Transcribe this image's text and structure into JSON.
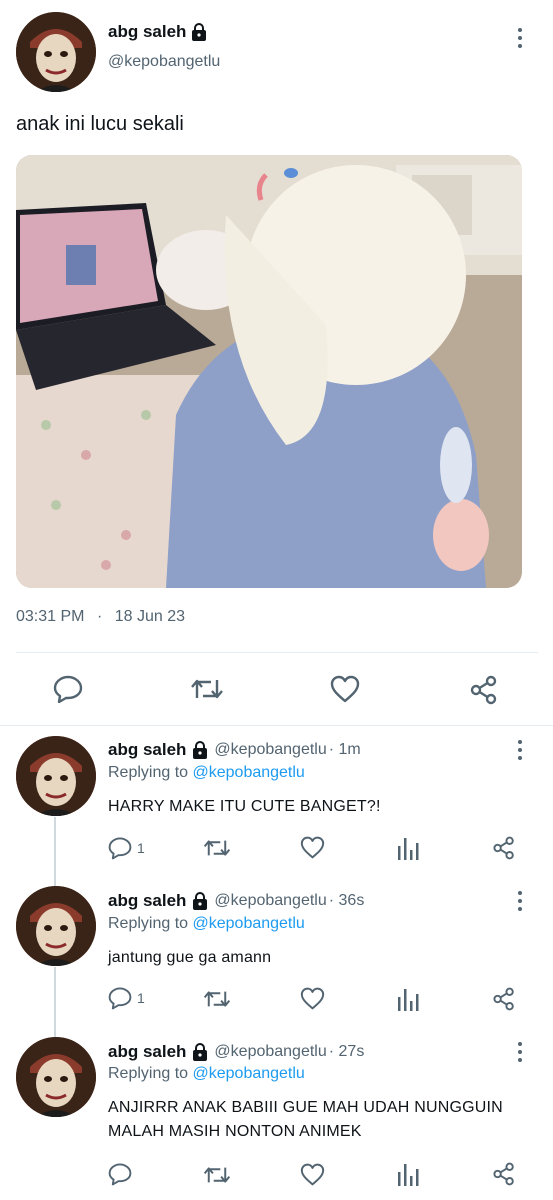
{
  "tweet": {
    "author_name": "abg saleh",
    "author_handle": "@kepobangetlu",
    "text": "anak ini lucu sekali",
    "time": "03:31 PM",
    "separator": "·",
    "date": "18 Jun 23"
  },
  "replies": [
    {
      "name": "abg saleh",
      "handle": "@kepobangetlu",
      "age": "· 1m",
      "replying_label": "Replying to",
      "replying_handle": "@kepobangetlu",
      "text": "HARRY MAKE ITU CUTE BANGET?!",
      "reply_count": "1"
    },
    {
      "name": "abg saleh",
      "handle": "@kepobangetlu",
      "age": "· 36s",
      "replying_label": "Replying to",
      "replying_handle": "@kepobangetlu",
      "text": "jantung gue ga amann",
      "reply_count": "1"
    },
    {
      "name": "abg saleh",
      "handle": "@kepobangetlu",
      "age": "· 27s",
      "replying_label": "Replying to",
      "replying_handle": "@kepobangetlu",
      "text_line1": "ANJIRRR ANAK BABIII GUE MAH UDAH NUNGGUIN",
      "text_line2": "MALAH MASIH NONTON ANIMEK",
      "reply_count": ""
    }
  ],
  "colors": {
    "accent": "#1d9bf0",
    "secondary_text": "#536471",
    "primary_text": "#0f1419",
    "divider": "#e6ecf0"
  },
  "icons": [
    "lock-icon",
    "more-icon",
    "reply-icon",
    "retweet-icon",
    "like-icon",
    "share-icon",
    "analytics-icon"
  ]
}
